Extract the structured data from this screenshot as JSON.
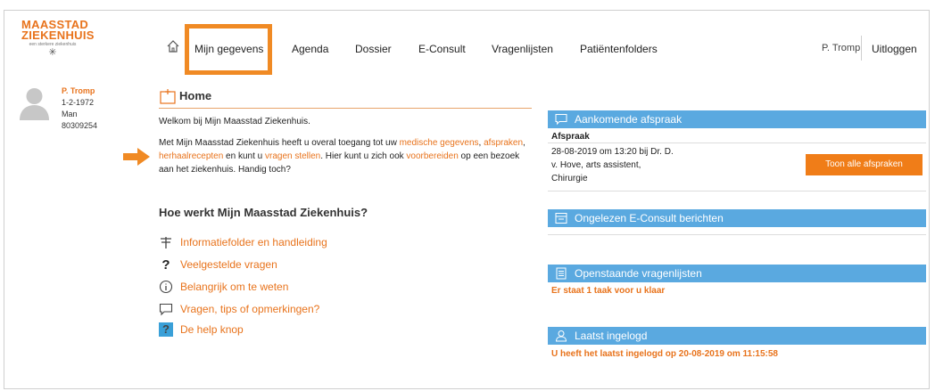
{
  "logo": {
    "line1": "MAASSTAD",
    "line2": "ZIEKENHUIS",
    "tagline": "een sterkere ziekenhuis"
  },
  "nav": {
    "items": [
      "Mijn gegevens",
      "Agenda",
      "Dossier",
      "E-Consult",
      "Vragenlijsten",
      "Patiëntenfolders"
    ],
    "user": "P. Tromp",
    "logout": "Uitloggen"
  },
  "profile": {
    "name": "P. Tromp",
    "dob": "1-2-1972",
    "gender": "Man",
    "id": "80309254"
  },
  "home": {
    "title": "Home",
    "welcome": "Welkom bij Mijn Maasstad Ziekenhuis.",
    "intro": {
      "p1": "Met Mijn Maasstad Ziekenhuis heeft u overal toegang tot uw ",
      "l1": "medische gegevens",
      "p2": ", ",
      "l2": "afspraken",
      "p3": ", ",
      "l3": "herhaalrecepten",
      "p4": " en kunt u ",
      "l4": "vragen stellen",
      "p5": ". Hier kunt u zich ook ",
      "l5": "voorbereiden",
      "p6": " op een bezoek aan het ziekenhuis. Handig toch?"
    },
    "how_title": "Hoe werkt Mijn Maasstad Ziekenhuis?",
    "links": [
      "Informatiefolder en handleiding",
      "Veelgestelde vragen",
      "Belangrijk om te weten",
      "Vragen, tips of opmerkingen?",
      "De help knop"
    ]
  },
  "panels": {
    "appointment": {
      "title": "Aankomende afspraak",
      "label": "Afspraak",
      "lines": [
        "28-08-2019 om 13:20 bij Dr. D.",
        "v. Hove, arts assistent,",
        "Chirurgie"
      ],
      "button": "Toon alle afspraken"
    },
    "econsult": {
      "title": "Ongelezen E-Consult berichten"
    },
    "questionnaires": {
      "title": "Openstaande vragenlijsten",
      "note": "Er staat 1 taak voor u klaar"
    },
    "lastlogin": {
      "title": "Laatst ingelogd",
      "note": "U heeft het laatst ingelogd op 20-08-2019 om 11:15:58"
    }
  },
  "colors": {
    "accent": "#e8731c",
    "panel": "#5aa9e0",
    "highlight": "#f08a24"
  }
}
